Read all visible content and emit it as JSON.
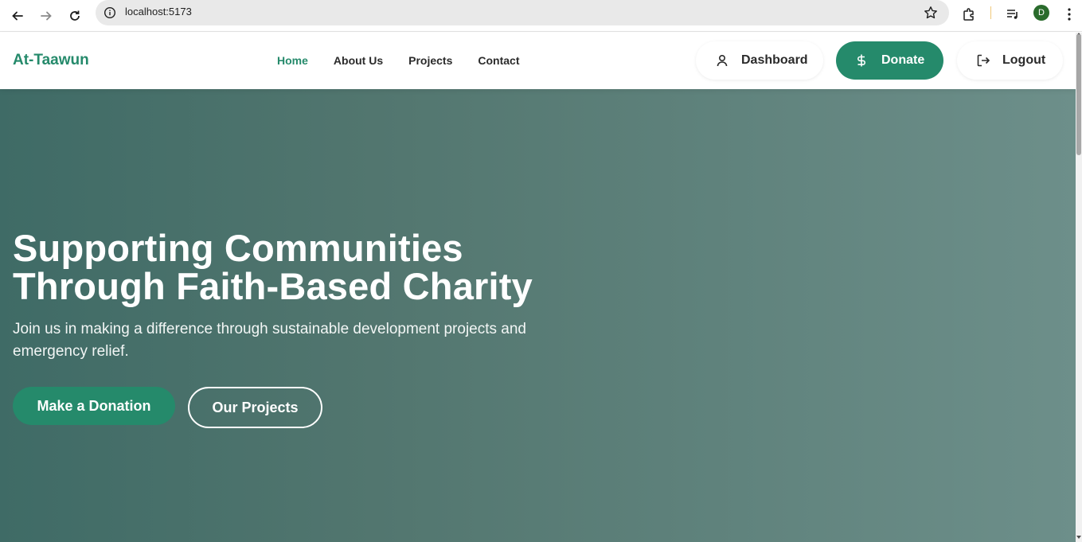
{
  "browser": {
    "url": "localhost:5173",
    "profile_initial": "D",
    "profile_color": "#2a6b2c",
    "icons": [
      "back-icon",
      "forward-icon",
      "reload-icon",
      "site-info-icon",
      "bookmark-star-icon",
      "extensions-icon",
      "media-control-icon",
      "more-menu-icon"
    ]
  },
  "header": {
    "brand": "At-Taawun",
    "nav": [
      {
        "label": "Home",
        "active": true
      },
      {
        "label": "About Us",
        "active": false
      },
      {
        "label": "Projects",
        "active": false
      },
      {
        "label": "Contact",
        "active": false
      }
    ],
    "dashboard_label": "Dashboard",
    "donate_label": "Donate",
    "logout_label": "Logout"
  },
  "hero": {
    "title": "Supporting Communities Through Faith-Based Charity",
    "subtitle": "Join us in making a difference through sustainable development projects and emergency relief.",
    "primary_cta": "Make a Donation",
    "secondary_cta": "Our Projects"
  },
  "colors": {
    "accent": "#258a6b",
    "hero_gradient_start": "#3f6b66",
    "hero_gradient_end": "#6d8f8a"
  }
}
